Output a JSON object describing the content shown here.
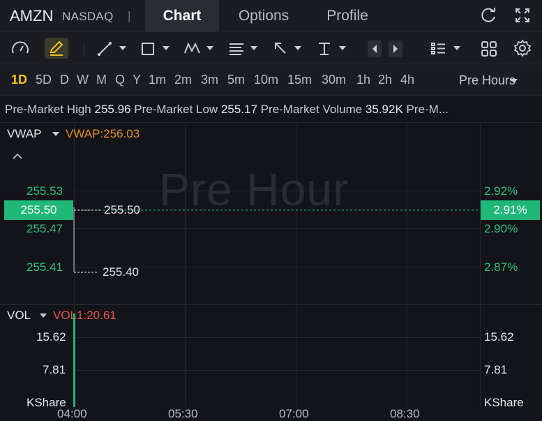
{
  "header": {
    "ticker": "AMZN",
    "exchange": "NASDAQ",
    "separator": "|",
    "tabs": [
      "Chart",
      "Options",
      "Profile"
    ],
    "active_tab": "Chart"
  },
  "toolbar": {
    "icons": [
      "gauge-icon",
      "highlighter-icon",
      "trendline-icon",
      "rectangle-icon",
      "wave-icon",
      "fibonacci-icon",
      "arrow-draw-icon",
      "vertical-line-icon",
      "prev-arrow-icon",
      "next-arrow-icon",
      "indicator-list-icon",
      "grid-icon",
      "settings-icon"
    ]
  },
  "periods": {
    "items": [
      "1D",
      "5D",
      "D",
      "W",
      "M",
      "Q",
      "Y",
      "1m",
      "2m",
      "3m",
      "5m",
      "10m",
      "15m",
      "30m",
      "1h",
      "2h",
      "4h"
    ],
    "active": "1D",
    "session": "Pre Hours"
  },
  "stats": {
    "high_label": "Pre-Market High",
    "high_value": "255.96",
    "low_label": "Pre-Market Low",
    "low_value": "255.17",
    "volume_label": "Pre-Market Volume",
    "volume_value": "35.92K",
    "more": "Pre-M..."
  },
  "price_panel": {
    "indicator": "VWAP",
    "indicator_value": "VWAP:256.03",
    "watermark": "Pre Hour",
    "left_axis": [
      "255.53",
      "255.47",
      "255.41"
    ],
    "right_axis": [
      "2.92%",
      "2.90%",
      "2.87%"
    ],
    "current_price": "255.50",
    "current_pct": "2.91%",
    "line_label_high": "255.50",
    "line_label_low": "255.40"
  },
  "volume_panel": {
    "indicator": "VOL",
    "indicator_value": "VOL1:20.61",
    "left_axis": [
      "15.62",
      "7.81",
      "KShare"
    ],
    "right_axis": [
      "15.62",
      "7.81",
      "KShare"
    ]
  },
  "time_axis": [
    "04:00",
    "05:30",
    "07:00",
    "08:30"
  ],
  "colors": {
    "up": "#2bc17e",
    "accent": "#f0c419",
    "vwap": "#e0901e",
    "vol": "#e2574c"
  }
}
